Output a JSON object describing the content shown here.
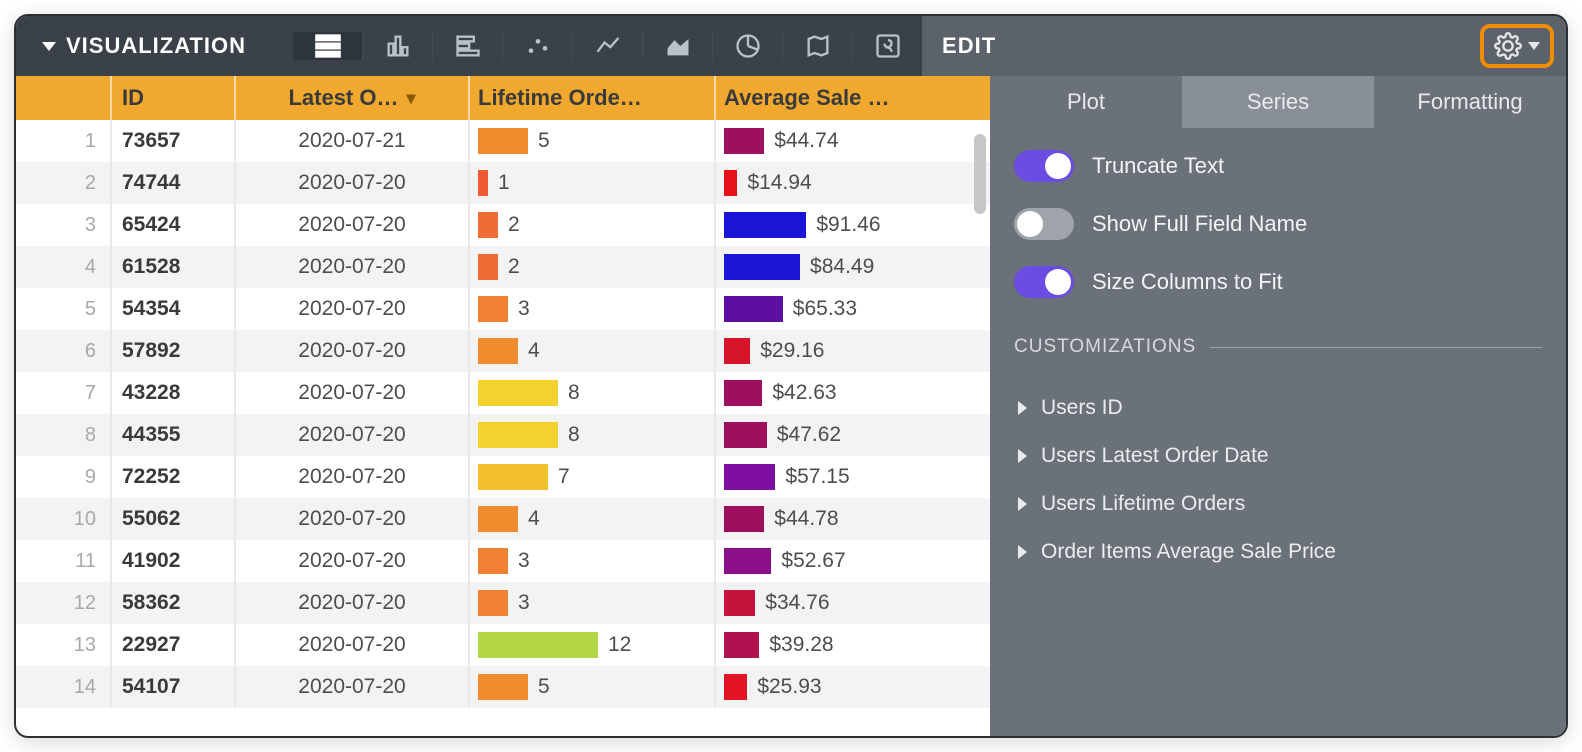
{
  "toolbar": {
    "title": "VISUALIZATION",
    "edit_label": "EDIT"
  },
  "tabs": {
    "plot": "Plot",
    "series": "Series",
    "formatting": "Formatting"
  },
  "columns": {
    "id": "ID",
    "latest_order": "Latest O…",
    "lifetime_orders": "Lifetime Orde…",
    "avg_sale": "Average Sale …"
  },
  "bar_max": {
    "orders": 15,
    "avg": 100
  },
  "rows": [
    {
      "n": "1",
      "id": "73657",
      "date": "2020-07-21",
      "orders": 5,
      "orders_color": "#f08c2e",
      "avg": "$44.74",
      "avg_v": 44.74,
      "avg_color": "#9e0f5e"
    },
    {
      "n": "2",
      "id": "74744",
      "date": "2020-07-20",
      "orders": 1,
      "orders_color": "#ef5a33",
      "avg": "$14.94",
      "avg_v": 14.94,
      "avg_color": "#e7111a"
    },
    {
      "n": "3",
      "id": "65424",
      "date": "2020-07-20",
      "orders": 2,
      "orders_color": "#f06c32",
      "avg": "$91.46",
      "avg_v": 91.46,
      "avg_color": "#1a14d6"
    },
    {
      "n": "4",
      "id": "61528",
      "date": "2020-07-20",
      "orders": 2,
      "orders_color": "#f06c32",
      "avg": "$84.49",
      "avg_v": 84.49,
      "avg_color": "#1a14d6"
    },
    {
      "n": "5",
      "id": "54354",
      "date": "2020-07-20",
      "orders": 3,
      "orders_color": "#f08032",
      "avg": "$65.33",
      "avg_v": 65.33,
      "avg_color": "#5d0fa4"
    },
    {
      "n": "6",
      "id": "57892",
      "date": "2020-07-20",
      "orders": 4,
      "orders_color": "#f08c2e",
      "avg": "$29.16",
      "avg_v": 29.16,
      "avg_color": "#d6152a"
    },
    {
      "n": "7",
      "id": "43228",
      "date": "2020-07-20",
      "orders": 8,
      "orders_color": "#f3d22e",
      "avg": "$42.63",
      "avg_v": 42.63,
      "avg_color": "#9e0f5e"
    },
    {
      "n": "8",
      "id": "44355",
      "date": "2020-07-20",
      "orders": 8,
      "orders_color": "#f3d22e",
      "avg": "$47.62",
      "avg_v": 47.62,
      "avg_color": "#9e0f5e"
    },
    {
      "n": "9",
      "id": "72252",
      "date": "2020-07-20",
      "orders": 7,
      "orders_color": "#f2bf2d",
      "avg": "$57.15",
      "avg_v": 57.15,
      "avg_color": "#7e0fa0"
    },
    {
      "n": "10",
      "id": "55062",
      "date": "2020-07-20",
      "orders": 4,
      "orders_color": "#f08c2e",
      "avg": "$44.78",
      "avg_v": 44.78,
      "avg_color": "#9e0f5e"
    },
    {
      "n": "11",
      "id": "41902",
      "date": "2020-07-20",
      "orders": 3,
      "orders_color": "#f08032",
      "avg": "$52.67",
      "avg_v": 52.67,
      "avg_color": "#8a0f88"
    },
    {
      "n": "12",
      "id": "58362",
      "date": "2020-07-20",
      "orders": 3,
      "orders_color": "#f08032",
      "avg": "$34.76",
      "avg_v": 34.76,
      "avg_color": "#c4143e"
    },
    {
      "n": "13",
      "id": "22927",
      "date": "2020-07-20",
      "orders": 12,
      "orders_color": "#b3d645",
      "avg": "$39.28",
      "avg_v": 39.28,
      "avg_color": "#b0124f"
    },
    {
      "n": "14",
      "id": "54107",
      "date": "2020-07-20",
      "orders": 5,
      "orders_color": "#f08c2e",
      "avg": "$25.93",
      "avg_v": 25.93,
      "avg_color": "#e21322"
    }
  ],
  "toggles": {
    "truncate": {
      "label": "Truncate Text",
      "on": true
    },
    "full_field": {
      "label": "Show Full Field Name",
      "on": false
    },
    "size_fit": {
      "label": "Size Columns to Fit",
      "on": true
    }
  },
  "customizations": {
    "header": "CUSTOMIZATIONS",
    "items": [
      "Users ID",
      "Users Latest Order Date",
      "Users Lifetime Orders",
      "Order Items Average Sale Price"
    ]
  }
}
